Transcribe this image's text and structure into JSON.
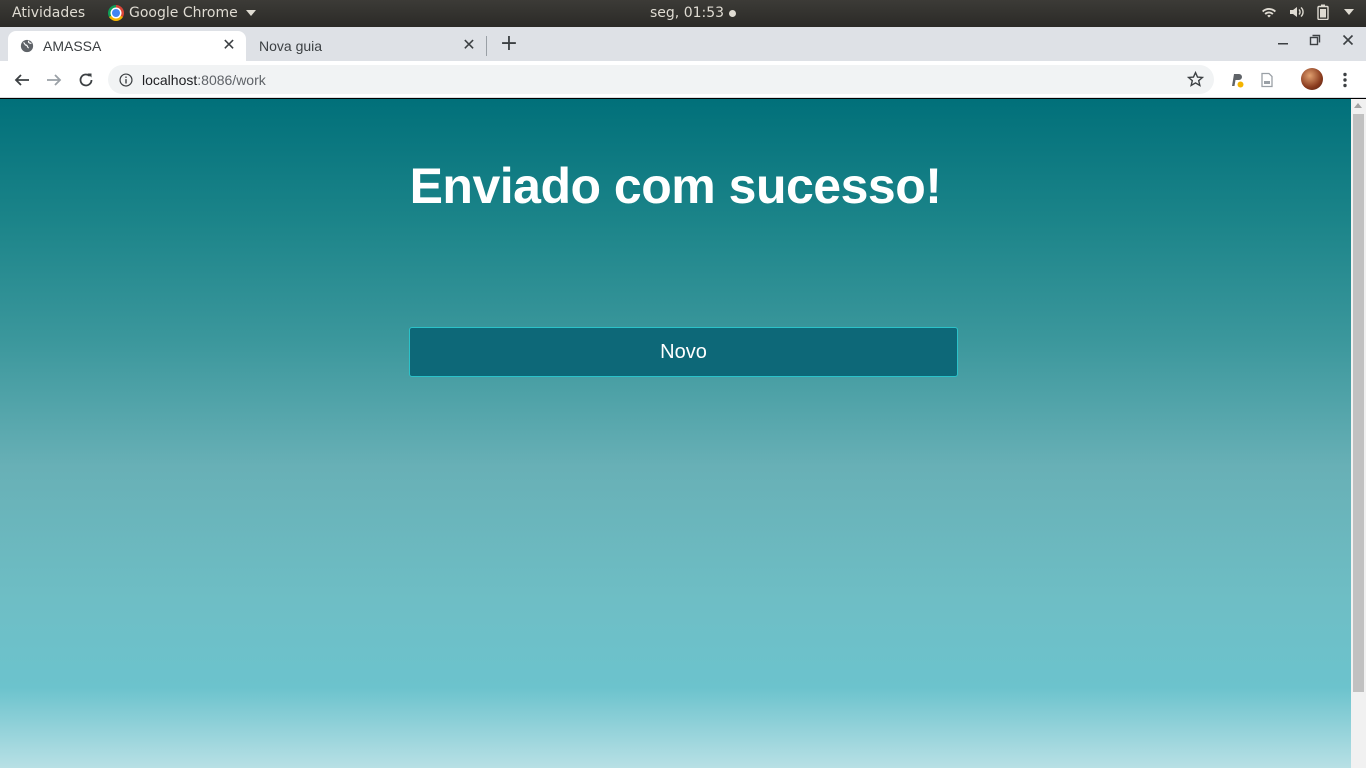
{
  "system_bar": {
    "activities": "Atividades",
    "app_name": "Google Chrome",
    "clock": "seg, 01:53"
  },
  "tabs": [
    {
      "title": "AMASSA",
      "active": true,
      "icon": "globe-icon"
    },
    {
      "title": "Nova guia",
      "active": false
    }
  ],
  "address_bar": {
    "host": "localhost",
    "rest": ":8086/work"
  },
  "page": {
    "heading": "Enviado com sucesso!",
    "button_label": "Novo"
  },
  "colors": {
    "page_top": "#01707a",
    "page_bottom": "#6cc3cd",
    "button_bg": "#0d6878",
    "button_border": "#2bc2c9"
  }
}
